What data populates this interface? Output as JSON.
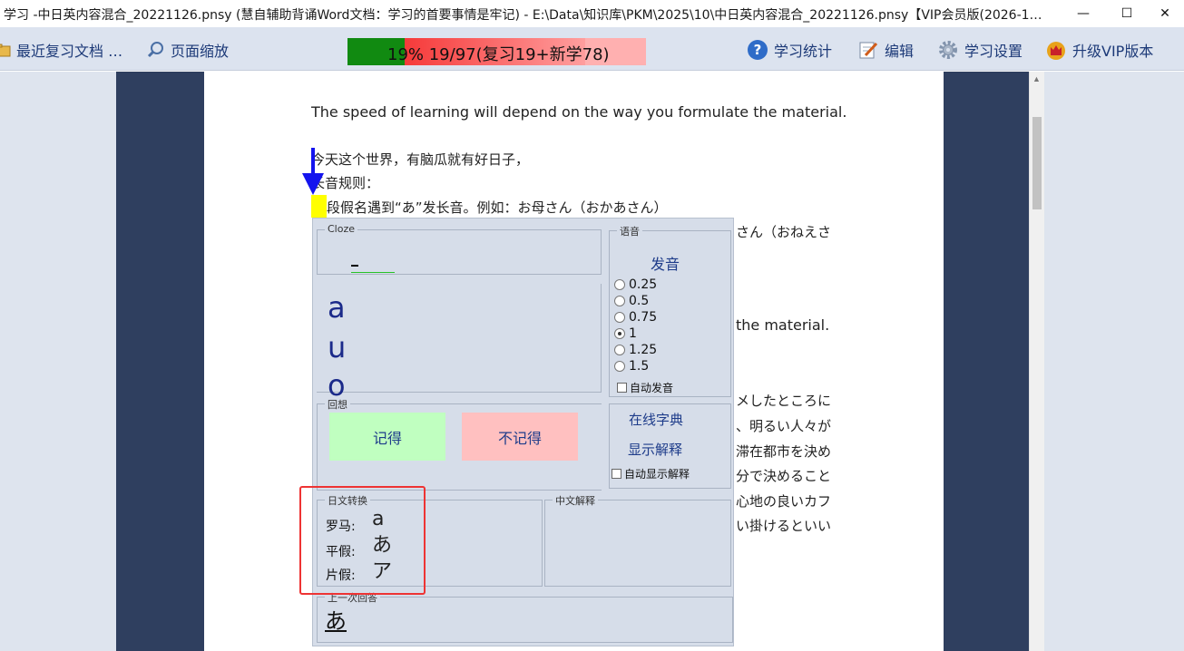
{
  "window": {
    "title": "学习 -中日英内容混合_20221126.pnsy (慧自辅助背诵Word文档：学习的首要事情是牢记) -  E:\\Data\\知识库\\PKM\\2025\\10\\中日英内容混合_20221126.pnsy【VIP会员版(2026-1…",
    "minimize": "—",
    "maximize": "☐",
    "close": "✕"
  },
  "toolbar": {
    "recent_docs": "最近复习文档 …",
    "page_zoom": "页面缩放",
    "progress_text": "19% 19/97(复习19+新学78)",
    "progress_fraction": 0.19,
    "stats": "学习统计",
    "edit": "编辑",
    "settings": "学习设置",
    "upgrade": "升级VIP版本"
  },
  "document": {
    "line1": "The speed of learning will depend on the way you formulate the material.",
    "line2": "今天这个世界，有脑瓜就有好日子，",
    "line3": "长音规则：",
    "line4": "段假名遇到“あ”发长音。例如：お母さん（おかあさん）",
    "line5": "さん（おねえさ",
    "line6": "the material.",
    "line7": "メしたところに",
    "line8": "、明るい人々が",
    "line9": "滞在都市を決め",
    "line10": "分で決めること",
    "line11": "心地の良いカフ",
    "line12": "い掛けるといい"
  },
  "dialog": {
    "cloze_title": "Cloze",
    "cloze_letters": [
      "a",
      "u",
      "o"
    ],
    "recall_title": "回想",
    "remember_btn": "记得",
    "forget_btn": "不记得",
    "voice_title": "语音",
    "pronounce": "发音",
    "speeds": [
      "0.25",
      "0.5",
      "0.75",
      "1",
      "1.25",
      "1.5"
    ],
    "selected_speed": "1",
    "auto_pronounce": "自动发音",
    "online_dict": "在线字典",
    "show_explain": "显示解释",
    "auto_show_explain": "自动显示解释",
    "jp_convert_title": "日文转换",
    "romaji_label": "罗马:",
    "romaji_value": "a",
    "hiragana_label": "平假:",
    "hiragana_value": "あ",
    "katakana_label": "片假:",
    "katakana_value": "ア",
    "cn_explain_title": "中文解释",
    "last_answer_title": "上一次回答",
    "last_answer_value": "あ"
  },
  "colors": {
    "toolbar_bg": "#dce3ef",
    "progress_green": "#118a11",
    "progress_red": "#f63a3a",
    "dark_side": "#2f3f5f",
    "dialog_bg": "#d6dde9",
    "highlight_red": "#ee3333"
  }
}
